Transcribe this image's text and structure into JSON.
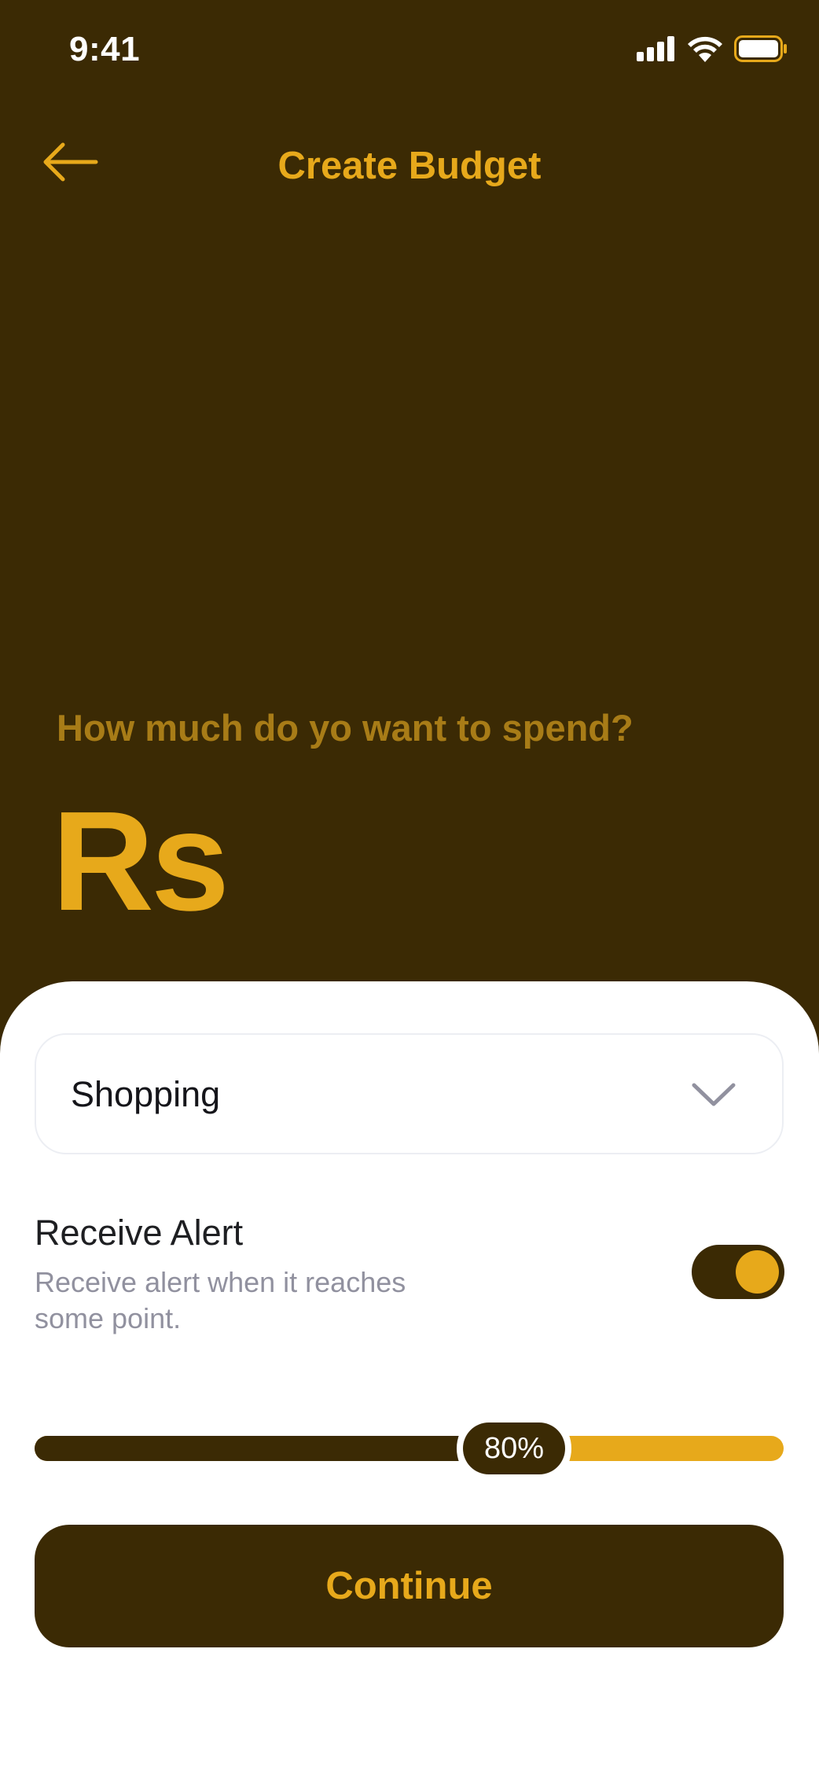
{
  "status_bar": {
    "time": "9:41"
  },
  "header": {
    "title": "Create Budget"
  },
  "amount": {
    "prompt": "How much do yo want to spend?",
    "currency": "Rs"
  },
  "category_select": {
    "value": "Shopping"
  },
  "alert": {
    "title": "Receive Alert",
    "description": "Receive alert when it reaches some point.",
    "enabled": true
  },
  "slider": {
    "value_percent": 80,
    "label": "80%"
  },
  "actions": {
    "continue_label": "Continue"
  },
  "colors": {
    "background": "#3b2a04",
    "accent": "#e7a91b",
    "sheet": "#ffffff",
    "muted_text": "#91919f"
  }
}
